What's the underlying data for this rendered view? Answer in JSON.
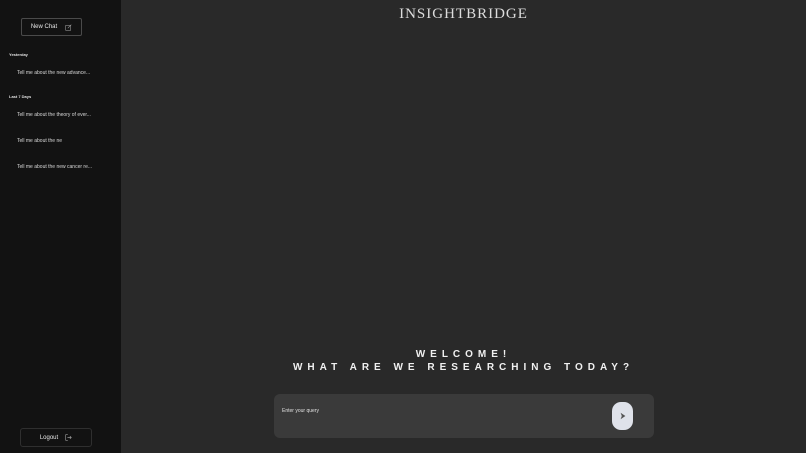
{
  "sidebar": {
    "new_chat_label": "New Chat",
    "sections": [
      {
        "label": "Yesterday",
        "items": [
          "Tell me about the new advance..."
        ]
      },
      {
        "label": "Last 7 Days",
        "items": [
          "Tell me about the theory of ever...",
          "Tell me about the ne",
          "Tell me about the new cancer re..."
        ]
      }
    ],
    "logout_label": "Logout"
  },
  "main": {
    "brand": "INSIGHTBRIDGE",
    "welcome_line1": "WELCOME!",
    "welcome_line2": "WHAT ARE WE RESEARCHING TODAY?",
    "query_placeholder": "Enter your query"
  },
  "icons": {
    "new_chat": "edit-icon",
    "logout": "logout-icon",
    "send": "send-arrow-icon"
  },
  "colors": {
    "sidebar_bg": "#121212",
    "main_bg": "#292929",
    "input_bg": "#3a3a3a",
    "send_btn_bg": "#dfe2ea"
  }
}
